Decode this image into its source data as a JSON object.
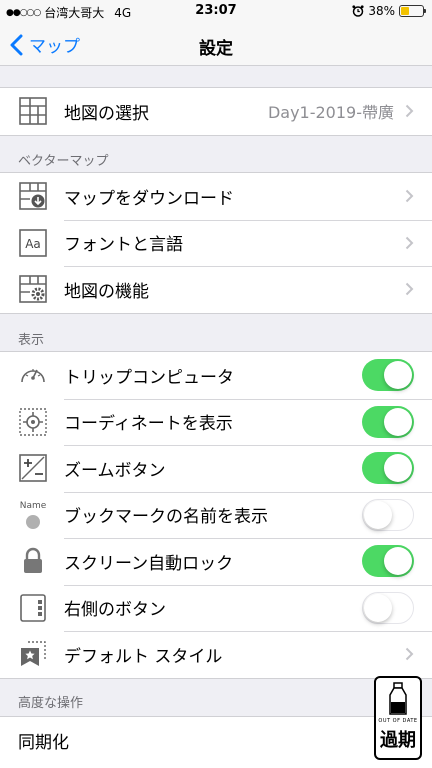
{
  "status_bar": {
    "signal": "●●○○○",
    "carrier": "台湾大哥大",
    "network": "4G",
    "time": "23:07",
    "battery": "38%",
    "battery_level": 0.38,
    "alarm_icon": "alarm-clock-icon"
  },
  "nav": {
    "back_label": "マップ",
    "title": "設定"
  },
  "map_section": {
    "label": "地図の選択",
    "value": "Day1-2019-帶廣"
  },
  "vector_section": {
    "header": "ベクターマップ",
    "items": [
      {
        "label": "マップをダウンロード"
      },
      {
        "label": "フォントと言語"
      },
      {
        "label": "地図の機能"
      }
    ]
  },
  "display_section": {
    "header": "表示",
    "items": [
      {
        "label": "トリップコンピュータ",
        "on": true
      },
      {
        "label": "コーディネートを表示",
        "on": true
      },
      {
        "label": "ズームボタン",
        "on": true
      },
      {
        "label": "ブックマークの名前を表示",
        "on": false,
        "icon_text": "Name"
      },
      {
        "label": "スクリーン自動ロック",
        "on": true
      },
      {
        "label": "右側のボタン",
        "on": false
      },
      {
        "label": "デフォルト スタイル"
      }
    ]
  },
  "advanced_section": {
    "header": "高度な操作",
    "items": [
      {
        "label": "同期化"
      }
    ]
  },
  "watermark": {
    "small_text": "OUT OF DATE",
    "big_text": "過期"
  },
  "colors": {
    "accent": "#0a7aff",
    "toggle_on": "#4cd964",
    "background": "#efeff4"
  }
}
